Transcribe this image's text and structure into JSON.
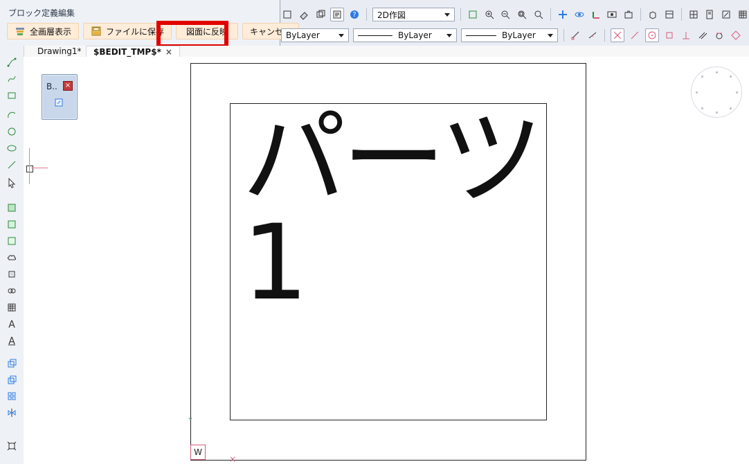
{
  "block_editor": {
    "title": "ブロック定義編集",
    "buttons": [
      {
        "label": "全画層表示",
        "icon": "layers-icon"
      },
      {
        "label": "ファイルに保存",
        "icon": "save-icon"
      },
      {
        "label": "図面に反映",
        "icon": ""
      },
      {
        "label": "キャンセル",
        "icon": ""
      }
    ]
  },
  "toolbar": {
    "workspace_select": "2D作図",
    "layer_color_select": "ByLayer",
    "linetype_select": "ByLayer",
    "lineweight_select": "ByLayer"
  },
  "tabs": [
    {
      "label": "Drawing1*",
      "active": false
    },
    {
      "label": "$BEDIT_TMP$*",
      "active": true
    }
  ],
  "mini_palette": {
    "title": "B.."
  },
  "canvas": {
    "part_text": "パーツ1",
    "ucs_label": "W"
  },
  "colors": {
    "highlight": "#e10000",
    "button_bg": "#ffecd9",
    "panel_bg": "#eef2f7",
    "ucs_x": "#d65b7a",
    "ucs_y": "#54a06e"
  }
}
